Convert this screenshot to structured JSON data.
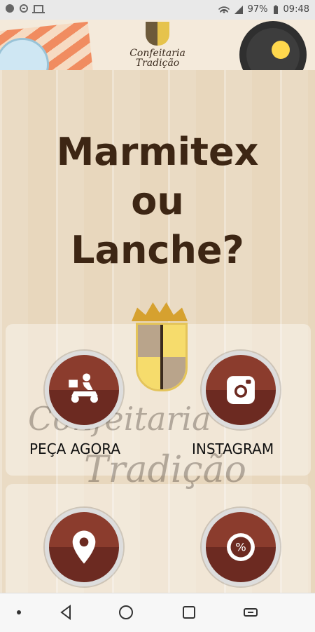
{
  "status_bar": {
    "battery": "97%",
    "time": "09:48",
    "icons": [
      "notification-dot-icon",
      "do-not-disturb-icon",
      "laptop-icon",
      "wifi-icon",
      "cell-signal-icon",
      "battery-icon"
    ]
  },
  "header": {
    "brand_line1": "Confeitaria",
    "brand_line2": "Tradição"
  },
  "hero": {
    "title_line1": "Marmitex",
    "title_line2": "ou",
    "title_line3": "Lanche?"
  },
  "actions": {
    "delivery_label": "PEÇA AGORA",
    "instagram_label": "INSTAGRAM"
  },
  "watermark": {
    "line1": "Confeitaria",
    "line2": "Tradição"
  },
  "colors": {
    "accent": "#8b3c2d",
    "title": "#3d2614"
  },
  "nav_icons": [
    "nav-dot-icon",
    "back-icon",
    "home-icon",
    "recents-icon",
    "rotate-icon"
  ]
}
